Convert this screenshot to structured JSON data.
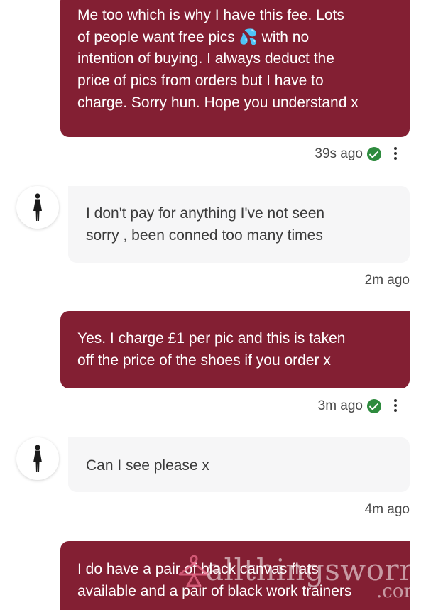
{
  "messages": [
    {
      "direction": "outgoing",
      "lines": [
        "Me too which is why I have this fee. Lots",
        "of people want free pics 💦 with no",
        "intention of buying. I always deduct the",
        "price of pics from orders but I have to",
        "charge. Sorry hun. Hope you understand x"
      ],
      "time": "39s ago"
    },
    {
      "direction": "incoming",
      "lines": [
        "I don't pay for anything I've not seen",
        "sorry , been conned too many times"
      ],
      "time": "2m ago"
    },
    {
      "direction": "outgoing",
      "lines": [
        "Yes. I charge £1 per pic and this is taken",
        "off the price of the shoes if you order x"
      ],
      "time": "3m ago"
    },
    {
      "direction": "incoming",
      "lines": [
        "Can I see please x"
      ],
      "time": "4m ago"
    },
    {
      "direction": "outgoing",
      "lines": [
        "I do have a pair of black canvas flats",
        "available and a pair of black work trainers"
      ]
    }
  ],
  "watermark": {
    "text": "allthingsworn",
    "suffix": ".com"
  },
  "colors": {
    "outgoing_bubble": "#831f33",
    "incoming_bubble": "#f6f6f7",
    "read_check": "#2e8b3e"
  },
  "icons": {
    "read_status": "check-circle-icon",
    "options": "kebab-menu-icon",
    "avatar": "female-silhouette-icon",
    "watermark_logo": "hanger-logo-icon"
  }
}
